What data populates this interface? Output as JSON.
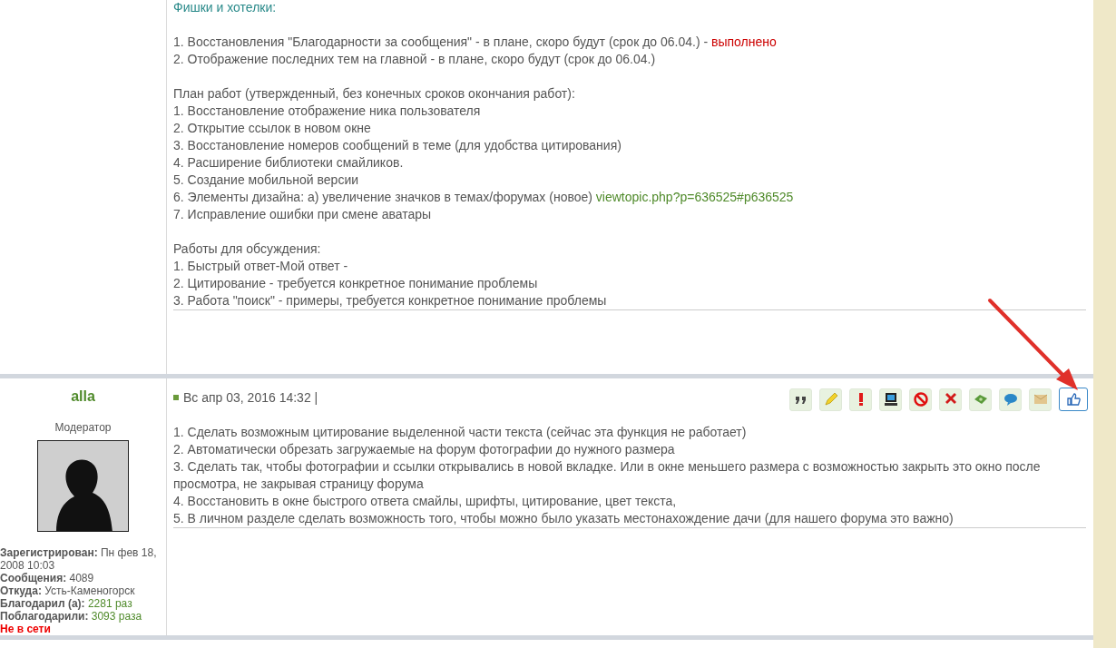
{
  "posts": [
    {
      "blocks": [
        {
          "lines": [
            [
              {
                "kind": "heading",
                "text": "Фишки и хотелки:"
              }
            ]
          ]
        },
        {
          "lines": [
            [
              {
                "kind": "text",
                "text": "1. Восстановления \"Благодарности за сообщения\" - в плане, скоро будут (срок до 06.04.) - "
              },
              {
                "kind": "done",
                "text": "выполнено"
              }
            ],
            [
              {
                "kind": "text",
                "text": "2. Отображение последних тем на главной - в плане, скоро будут (срок до 06.04.)"
              }
            ]
          ]
        },
        {
          "lines": [
            [
              {
                "kind": "text",
                "text": "План работ (утвержденный, без конечных сроков окончания работ):"
              }
            ],
            [
              {
                "kind": "text",
                "text": "1. Восстановление отображение ника пользователя"
              }
            ],
            [
              {
                "kind": "text",
                "text": "2. Открытие ссылок в новом окне"
              }
            ],
            [
              {
                "kind": "text",
                "text": "3. Восстановление номеров сообщений в теме (для удобства цитирования)"
              }
            ],
            [
              {
                "kind": "text",
                "text": "4. Расширение библиотеки смайликов."
              }
            ],
            [
              {
                "kind": "text",
                "text": "5. Создание мобильной версии"
              }
            ],
            [
              {
                "kind": "text",
                "text": "6. Элементы дизайна: а) увеличение значков в темах/форумах (новое) "
              },
              {
                "kind": "link",
                "text": "viewtopic.php?p=636525#p636525"
              }
            ],
            [
              {
                "kind": "text",
                "text": "7. Исправление ошибки при смене аватары"
              }
            ]
          ]
        },
        {
          "lines": [
            [
              {
                "kind": "text",
                "text": "Работы для обсуждения:"
              }
            ],
            [
              {
                "kind": "text",
                "text": "1. Быстрый ответ-Мой ответ -"
              }
            ],
            [
              {
                "kind": "text",
                "text": "2. Цитирование - требуется конкретное понимание проблемы"
              }
            ],
            [
              {
                "kind": "text",
                "text": "3. Работа \"поиск\" - примеры, требуется конкретное понимание проблемы"
              }
            ]
          ]
        }
      ]
    },
    {
      "author": {
        "name": "alla",
        "rank": "Модератор",
        "fields": [
          {
            "label": "Зарегистрирован:",
            "value": "Пн фев 18, 2008 10:03",
            "kind": "plain"
          },
          {
            "label": "Сообщения:",
            "value": "4089",
            "kind": "plain"
          },
          {
            "label": "Откуда:",
            "value": "Усть-Каменогорск",
            "kind": "plain"
          },
          {
            "label": "Благодарил (а):",
            "value": "2281 раз",
            "kind": "link"
          },
          {
            "label": "Поблагодарили:",
            "value": "3093 раза",
            "kind": "link"
          }
        ],
        "status": "Не в сети"
      },
      "date": "Вс апр 03, 2016 14:32 |",
      "buttons": [
        {
          "kind": "quote",
          "selected": false
        },
        {
          "kind": "edit",
          "selected": false
        },
        {
          "kind": "report",
          "selected": false
        },
        {
          "kind": "ip",
          "selected": false
        },
        {
          "kind": "ban",
          "selected": false
        },
        {
          "kind": "delete",
          "selected": false
        },
        {
          "kind": "money",
          "selected": false
        },
        {
          "kind": "message",
          "selected": false
        },
        {
          "kind": "email",
          "selected": false
        },
        {
          "kind": "like",
          "selected": true
        }
      ],
      "blocks": [
        {
          "lines": [
            [
              {
                "kind": "text",
                "text": "1. Сделать возможным цитирование выделенной части текста (сейчас эта функция не работает)"
              }
            ],
            [
              {
                "kind": "text",
                "text": "2. Автоматически обрезать загружаемые на форум фотографии до нужного размера"
              }
            ],
            [
              {
                "kind": "text",
                "text": "3. Сделать так, чтобы фотографии и ссылки открывались в новой вкладке. Или в окне меньшего размера с возможностью закрыть это окно после просмотра, не закрывая страницу форума"
              }
            ],
            [
              {
                "kind": "text",
                "text": "4. Восстановить в окне быстрого ответа смайлы, шрифты, цитирование, цвет текста,"
              }
            ],
            [
              {
                "kind": "text",
                "text": "5. В личном разделе сделать возможность того, чтобы можно было указать местонахождение дачи (для нашего форума это важно)"
              }
            ]
          ]
        }
      ]
    }
  ]
}
